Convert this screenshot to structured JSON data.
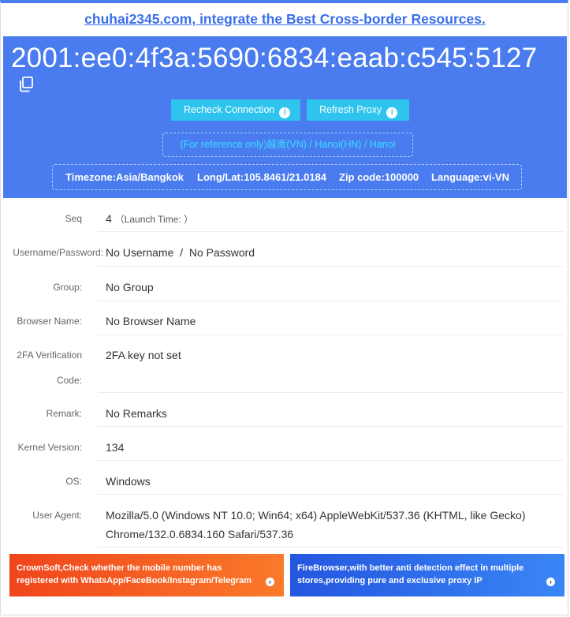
{
  "header": {
    "site_link": "chuhai2345.com, integrate the Best Cross-border Resources."
  },
  "hero": {
    "ip": "2001:ee0:4f3a:5690:6834:eaab:c545:5127",
    "recheck_label": "Recheck Connection",
    "refresh_label": "Refresh Proxy",
    "info_glyph": "i",
    "location_prefix": "(For reference only)",
    "location_detail": "越南(VN) / Hanoi(HN) / Hanoi",
    "timezone": "Timezone:Asia/Bangkok",
    "longlat": "Long/Lat:105.8461/21.0184",
    "zip": "Zip code:100000",
    "language": "Language:vi-VN"
  },
  "details": {
    "seq_label": "Seq",
    "seq_value": "4",
    "launch_time": "（Launch Time: ）",
    "cred_label": "Username/Password:",
    "username": "No Username",
    "cred_sep": "/",
    "password": "No Password",
    "group_label": "Group:",
    "group_value": "No Group",
    "browser_label": "Browser Name:",
    "browser_value": "No Browser Name",
    "twofa_label_1": "2FA Verification",
    "twofa_label_2": "Code:",
    "twofa_value": "2FA key not set",
    "remark_label": "Remark:",
    "remark_value": "No Remarks",
    "kernel_label": "Kernel Version:",
    "kernel_value": "134",
    "os_label": "OS:",
    "os_value": "Windows",
    "ua_label": "User Agent:",
    "ua_line1": "Mozilla/5.0 (Windows NT 10.0; Win64; x64) AppleWebKit/537.36 (KHTML, like Gecko)",
    "ua_line2": "Chrome/132.0.6834.160 Safari/537.36"
  },
  "banners": {
    "left_text": "CrownSoft,Check whether the mobile number has registered with WhatsApp/FaceBook/Instagram/Telegram",
    "right_text": "FireBrowser,with better anti detection effect in multiple stores,providing pure and exclusive proxy IP",
    "arrow_glyph": "›"
  },
  "colors": {
    "hero_bg": "#4a7cf0",
    "button_bg": "#2ec4ee",
    "link": "#3a6fe8",
    "highlight": "#36e0ff"
  },
  "icons": [
    "copy-icon",
    "info-icon",
    "arrow-right-icon"
  ]
}
